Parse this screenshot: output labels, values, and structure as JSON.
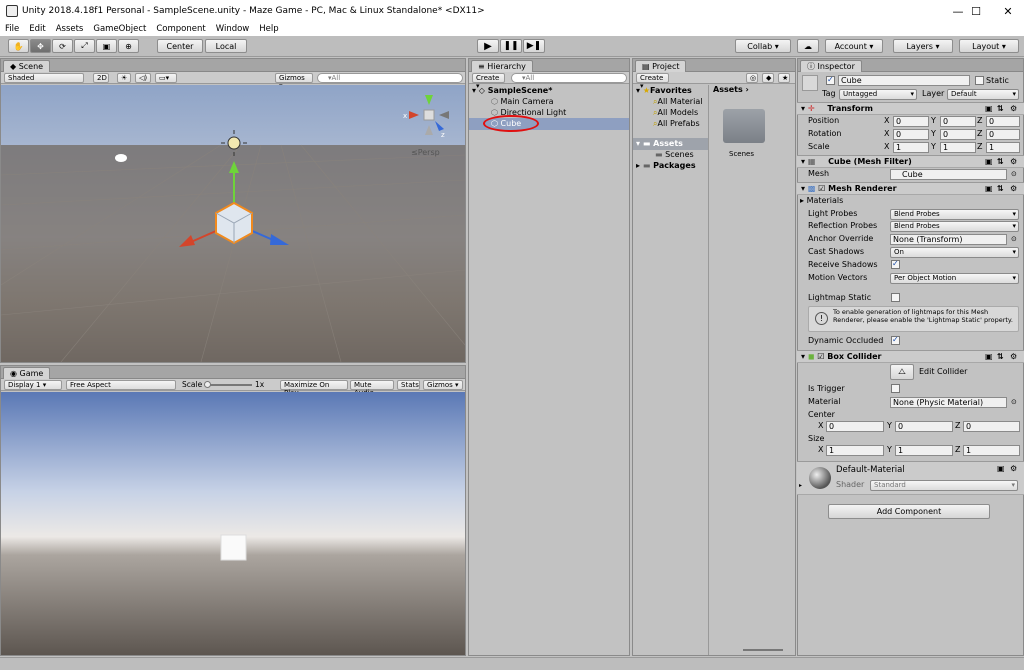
{
  "window": {
    "title": "Unity 2018.4.18f1 Personal - SampleScene.unity - Maze Game - PC, Mac & Linux Standalone* <DX11>",
    "minimize": "—",
    "maximize": "☐",
    "close": "✕"
  },
  "menu": [
    "File",
    "Edit",
    "Assets",
    "GameObject",
    "Component",
    "Window",
    "Help"
  ],
  "toolbar": {
    "center": "Center",
    "local": "Local",
    "collab": "Collab",
    "account": "Account",
    "layers": "Layers",
    "layout": "Layout"
  },
  "scene": {
    "tab": "Scene",
    "shading": "Shaded",
    "mode2d": "2D",
    "gizmos": "Gizmos",
    "search": "▾All",
    "persp": "≤Persp",
    "axes": {
      "x": "x",
      "z": "z"
    }
  },
  "game": {
    "tab": "Game",
    "display": "Display 1",
    "aspect": "Free Aspect",
    "scale_label": "Scale",
    "scale_value": "1x",
    "maximize": "Maximize On Play",
    "mute": "Mute Audio",
    "stats": "Stats",
    "gizmos": "Gizmos"
  },
  "hierarchy": {
    "tab": "Hierarchy",
    "create": "Create",
    "search": "▾All",
    "scene": "SampleScene*",
    "items": [
      "Main Camera",
      "Directional Light",
      "Cube"
    ]
  },
  "project": {
    "tab": "Project",
    "create": "Create",
    "favorites": "Favorites",
    "fav_items": [
      "All Material",
      "All Models",
      "All Prefabs"
    ],
    "assets": "Assets",
    "packages": "Packages",
    "scenes": "Scenes",
    "breadcrumb": "Assets",
    "folder": "Scenes"
  },
  "inspector": {
    "tab": "Inspector",
    "name": "Cube",
    "static": "Static",
    "tag_label": "Tag",
    "tag": "Untagged",
    "layer_label": "Layer",
    "layer": "Default",
    "transform": {
      "title": "Transform",
      "position": "Position",
      "rotation": "Rotation",
      "scale": "Scale",
      "px": "0",
      "py": "0",
      "pz": "0",
      "rx": "0",
      "ry": "0",
      "rz": "0",
      "sx": "1",
      "sy": "1",
      "sz": "1"
    },
    "meshfilter": {
      "title": "Cube (Mesh Filter)",
      "mesh_label": "Mesh",
      "mesh": "Cube"
    },
    "renderer": {
      "title": "Mesh Renderer",
      "materials": "Materials",
      "light_probes": "Light Probes",
      "light_probes_v": "Blend Probes",
      "refl_probes": "Reflection Probes",
      "refl_probes_v": "Blend Probes",
      "anchor": "Anchor Override",
      "anchor_v": "None (Transform)",
      "cast": "Cast Shadows",
      "cast_v": "On",
      "receive": "Receive Shadows",
      "motion": "Motion Vectors",
      "motion_v": "Per Object Motion",
      "lightmap": "Lightmap Static",
      "info": "To enable generation of lightmaps for this Mesh Renderer, please enable the 'Lightmap Static' property.",
      "dynamic": "Dynamic Occluded"
    },
    "collider": {
      "title": "Box Collider",
      "edit": "Edit Collider",
      "trigger": "Is Trigger",
      "material_label": "Material",
      "material": "None (Physic Material)",
      "center": "Center",
      "size": "Size",
      "cx": "0",
      "cy": "0",
      "cz": "0",
      "sx": "1",
      "sy": "1",
      "sz": "1"
    },
    "material": {
      "name": "Default-Material",
      "shader_label": "Shader",
      "shader": "Standard"
    },
    "add_component": "Add Component"
  },
  "x": "X",
  "y": "Y",
  "z": "Z"
}
